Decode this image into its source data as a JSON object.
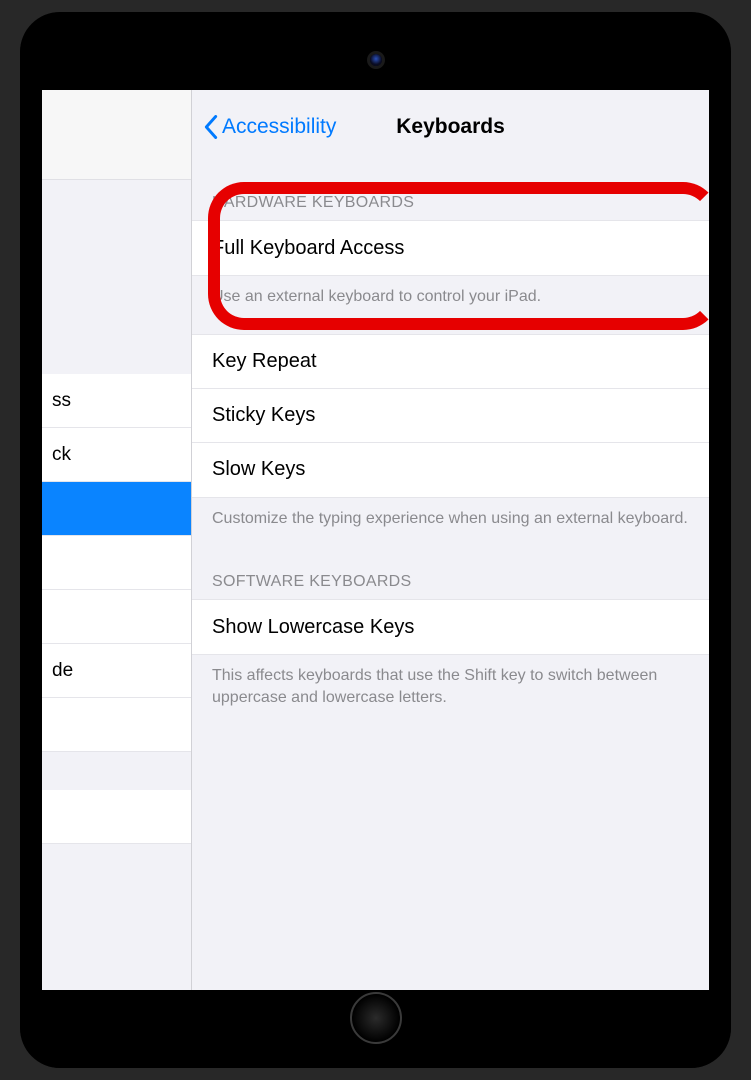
{
  "navigation": {
    "back_label": "Accessibility",
    "title": "Keyboards"
  },
  "sidebar": {
    "rows": [
      "ss",
      "ck",
      "",
      "",
      "",
      "de",
      "",
      ""
    ]
  },
  "sections": {
    "hardware": {
      "header": "HARDWARE KEYBOARDS",
      "full_keyboard_access": "Full Keyboard Access",
      "full_keyboard_footer": "Use an external keyboard to control your iPad.",
      "key_repeat": "Key Repeat",
      "sticky_keys": "Sticky Keys",
      "slow_keys": "Slow Keys",
      "typing_footer": "Customize the typing experience when using an external keyboard."
    },
    "software": {
      "header": "SOFTWARE KEYBOARDS",
      "show_lowercase": "Show Lowercase Keys",
      "footer": "This affects keyboards that use the Shift key to switch between uppercase and lowercase letters."
    }
  }
}
